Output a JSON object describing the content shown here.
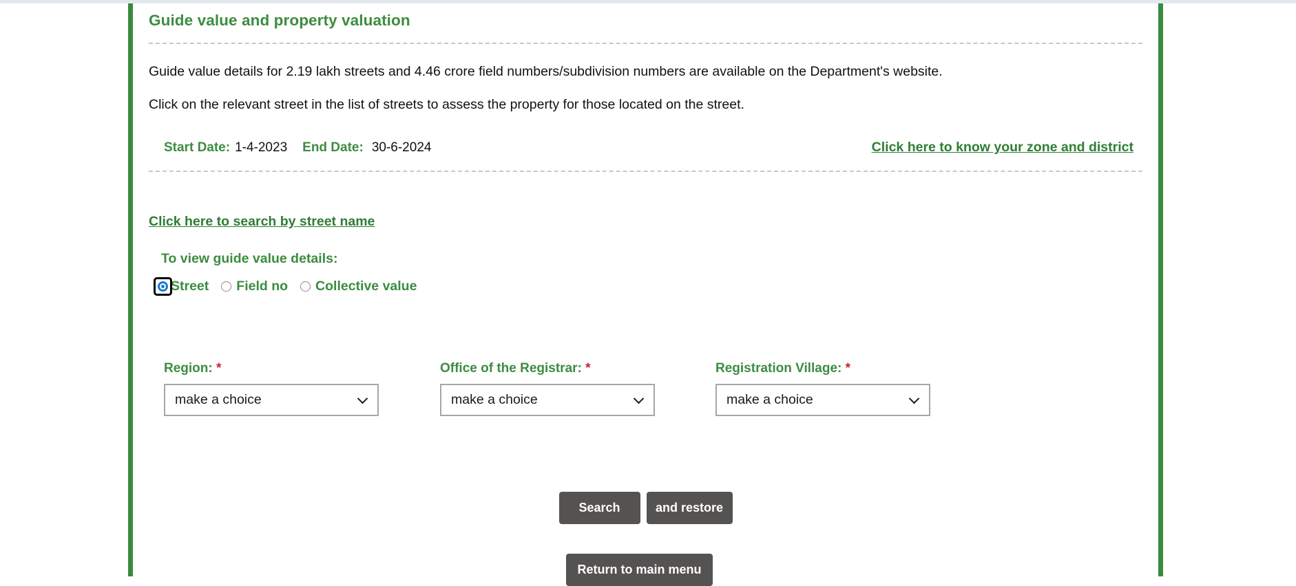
{
  "panel": {
    "title": "Guide value and property valuation",
    "paragraph_1": "Guide value details for 2.19 lakh streets and 4.46 crore field numbers/subdivision numbers are available on the Department's website.",
    "paragraph_2": "Click on the relevant street in the list of streets to assess the property for those located on the street."
  },
  "dates": {
    "start_label": "Start Date:",
    "start_value": "1-4-2023",
    "end_label": "End Date:",
    "end_value": "30-6-2024"
  },
  "links": {
    "zone_district": "Click here to know your zone and district",
    "search_by_street": "Click here to search by street name"
  },
  "search_mode": {
    "heading": "To view guide value details:",
    "options": [
      {
        "label": "Street",
        "checked": true
      },
      {
        "label": "Field no",
        "checked": false
      },
      {
        "label": "Collective value",
        "checked": false
      }
    ]
  },
  "fields": [
    {
      "label": "Region:",
      "required_mark": "*",
      "value": "make a choice",
      "options": [
        "make a choice"
      ]
    },
    {
      "label": "Office of the Registrar:",
      "required_mark": "*",
      "value": "make a choice",
      "options": [
        "make a choice"
      ]
    },
    {
      "label": "Registration Village:",
      "required_mark": "*",
      "value": "make a choice",
      "options": [
        "make a choice"
      ]
    }
  ],
  "buttons": {
    "search": "Search",
    "reset": "and restore",
    "return_main_menu": "Return to main menu"
  },
  "colors": {
    "brand_green": "#3c8c40",
    "rail_green": "#3a8a3f",
    "link_green": "#2f7d34",
    "required_red": "#cc1f2b",
    "button_gray": "#555352",
    "top_strip": "#e3e7ee"
  }
}
